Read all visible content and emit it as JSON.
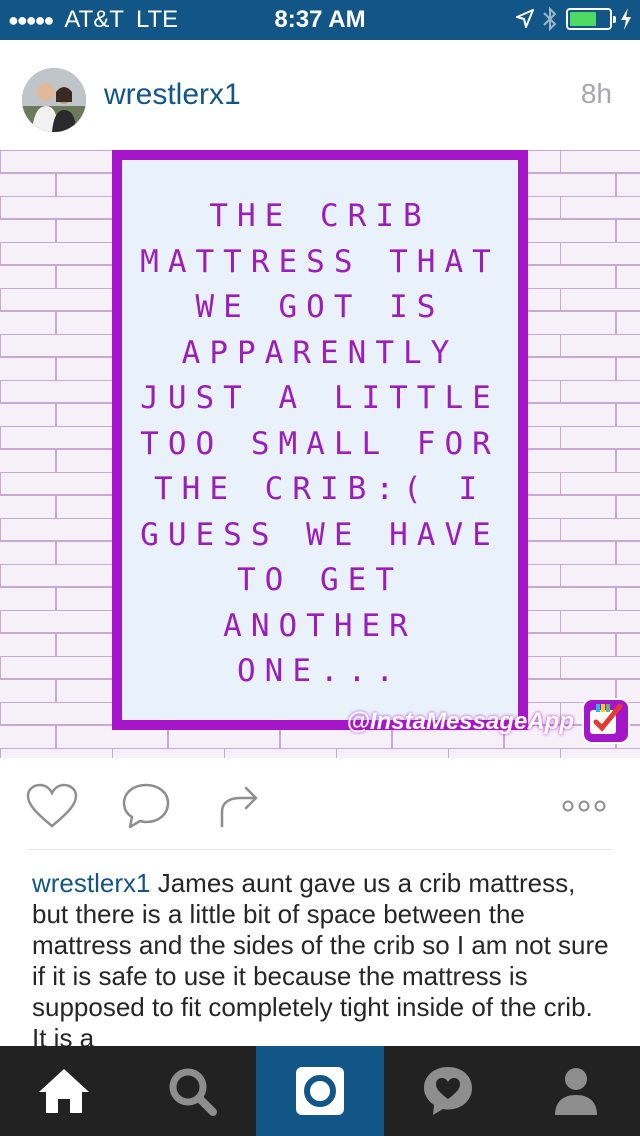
{
  "status_bar": {
    "signal": "●●●●●",
    "carrier": "AT&T",
    "network": "LTE",
    "time": "8:37 AM"
  },
  "post": {
    "username": "wrestlerx1",
    "time_ago": "8h",
    "image_text_lines": [
      "THE CRIB",
      "MATTRESS THAT",
      "WE GOT IS",
      "APPARENTLY",
      "JUST A LITTLE",
      "TOO SMALL FOR",
      "THE CRIB:( I",
      "GUESS WE HAVE",
      "TO GET",
      "ANOTHER",
      "ONE..."
    ],
    "watermark": "@InstaMessageApp",
    "caption_user": "wrestlerx1",
    "caption_text": " James aunt gave us a crib mattress, but there is a little bit of space between the mattress and the sides of the crib so I am not sure if it is safe to use it because the mattress is supposed to fit completely tight inside of the crib. It is a"
  },
  "icons": {
    "like": "heart-icon",
    "comment": "comment-icon",
    "share": "share-icon",
    "more": "more-icon"
  },
  "tab_bar": {
    "tabs": [
      "home",
      "search",
      "camera",
      "activity",
      "profile"
    ],
    "active": "camera"
  },
  "colors": {
    "brand_blue": "#125688",
    "frame_purple": "#a515c9",
    "tab_bar_bg": "#222222",
    "battery_green": "#4cd964"
  }
}
